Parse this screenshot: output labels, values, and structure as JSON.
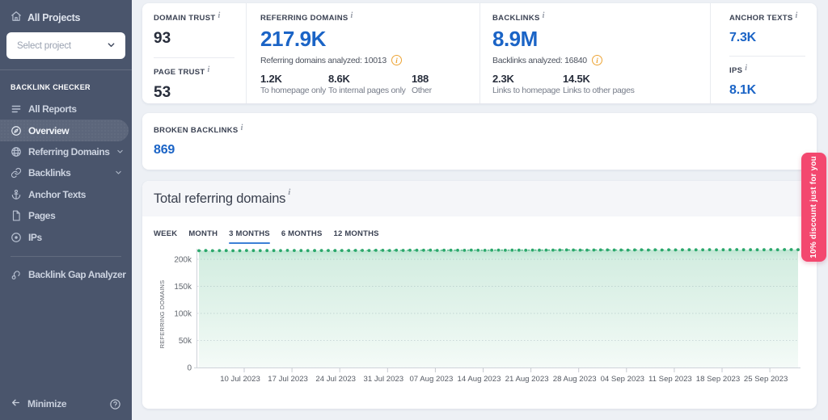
{
  "sidebar": {
    "all_projects_label": "All Projects",
    "project_select_placeholder": "Select project",
    "section_label": "BACKLINK CHECKER",
    "items": [
      {
        "label": "All Reports"
      },
      {
        "label": "Overview"
      },
      {
        "label": "Referring Domains"
      },
      {
        "label": "Backlinks"
      },
      {
        "label": "Anchor Texts"
      },
      {
        "label": "Pages"
      },
      {
        "label": "IPs"
      }
    ],
    "tools": [
      {
        "label": "Backlink Gap Analyzer"
      }
    ],
    "minimize_label": "Minimize"
  },
  "metrics": {
    "domain_trust": {
      "label": "DOMAIN TRUST",
      "value": "93"
    },
    "page_trust": {
      "label": "PAGE TRUST",
      "value": "53"
    },
    "referring_domains": {
      "label": "REFERRING DOMAINS",
      "value": "217.9K",
      "analyzed": "Referring domains analyzed: 10013",
      "stats": [
        {
          "value": "1.2K",
          "caption": "To homepage only"
        },
        {
          "value": "8.6K",
          "caption": "To internal pages only"
        },
        {
          "value": "188",
          "caption": "Other"
        }
      ]
    },
    "backlinks": {
      "label": "BACKLINKS",
      "value": "8.9M",
      "analyzed": "Backlinks analyzed: 16840",
      "stats": [
        {
          "value": "2.3K",
          "caption": "Links to homepage"
        },
        {
          "value": "14.5K",
          "caption": "Links to other pages"
        }
      ]
    },
    "anchor_texts": {
      "label": "ANCHOR TEXTS",
      "value": "7.3K"
    },
    "ips": {
      "label": "IPS",
      "value": "8.1K"
    },
    "broken_backlinks": {
      "label": "BROKEN BACKLINKS",
      "value": "869"
    }
  },
  "chart_section": {
    "title": "Total referring domains",
    "tabs": [
      {
        "label": "WEEK",
        "active": false
      },
      {
        "label": "MONTH",
        "active": false
      },
      {
        "label": "3 MONTHS",
        "active": true
      },
      {
        "label": "6 MONTHS",
        "active": false
      },
      {
        "label": "12 MONTHS",
        "active": false
      }
    ]
  },
  "ribbon": {
    "text": "10% discount just for you"
  },
  "colors": {
    "sidebar_bg": "#4b5670",
    "accent_blue": "#1b64c6",
    "tab_underline": "#3c80d6",
    "green_line": "#2aa76b",
    "ribbon_pink": "#f3486f",
    "info_orange": "#eda435"
  },
  "chart_data": {
    "type": "area",
    "title": "Total referring domains",
    "ylabel": "REFERRING DOMAINS",
    "x_start": "04 Jul 2023",
    "x_end": "30 Sep 2023",
    "x_tick_labels": [
      "10 Jul 2023",
      "17 Jul 2023",
      "24 Jul 2023",
      "31 Jul 2023",
      "07 Aug 2023",
      "14 Aug 2023",
      "21 Aug 2023",
      "28 Aug 2023",
      "04 Sep 2023",
      "11 Sep 2023",
      "18 Sep 2023",
      "25 Sep 2023"
    ],
    "y_tick_labels": [
      "0",
      "50k",
      "100k",
      "150k",
      "200k"
    ],
    "y_tick_values": [
      0,
      50000,
      100000,
      150000,
      200000
    ],
    "ylim": [
      0,
      228000
    ],
    "grid": true,
    "legend": false,
    "series": [
      {
        "name": "Referring domains",
        "values": [
          215820,
          216160,
          215770,
          215920,
          216070,
          215780,
          215820,
          216220,
          216100,
          215900,
          216060,
          216190,
          215940,
          216400,
          216220,
          216090,
          216020,
          216070,
          216270,
          216280,
          216120,
          216240,
          216180,
          216440,
          216400,
          216230,
          216640,
          216530,
          216330,
          216770,
          216420,
          216650,
          216680,
          216670,
          216880,
          216450,
          216740,
          216760,
          216690,
          216530,
          217030,
          216660,
          216600,
          216880,
          217060,
          216710,
          216810,
          216900,
          216780,
          217000,
          216810,
          217060,
          216950,
          217100,
          217260,
          217210,
          216970,
          216960,
          217220,
          217240,
          217300,
          217090,
          217200,
          217080,
          217340,
          217440,
          217130,
          217410,
          217180,
          217480,
          217300,
          217470,
          217580,
          217530,
          217500,
          217700,
          217480,
          217580,
          217660,
          217860,
          217640,
          217620,
          217610,
          217600,
          217900,
          217610,
          217900,
          217960,
          217710
        ]
      }
    ]
  }
}
